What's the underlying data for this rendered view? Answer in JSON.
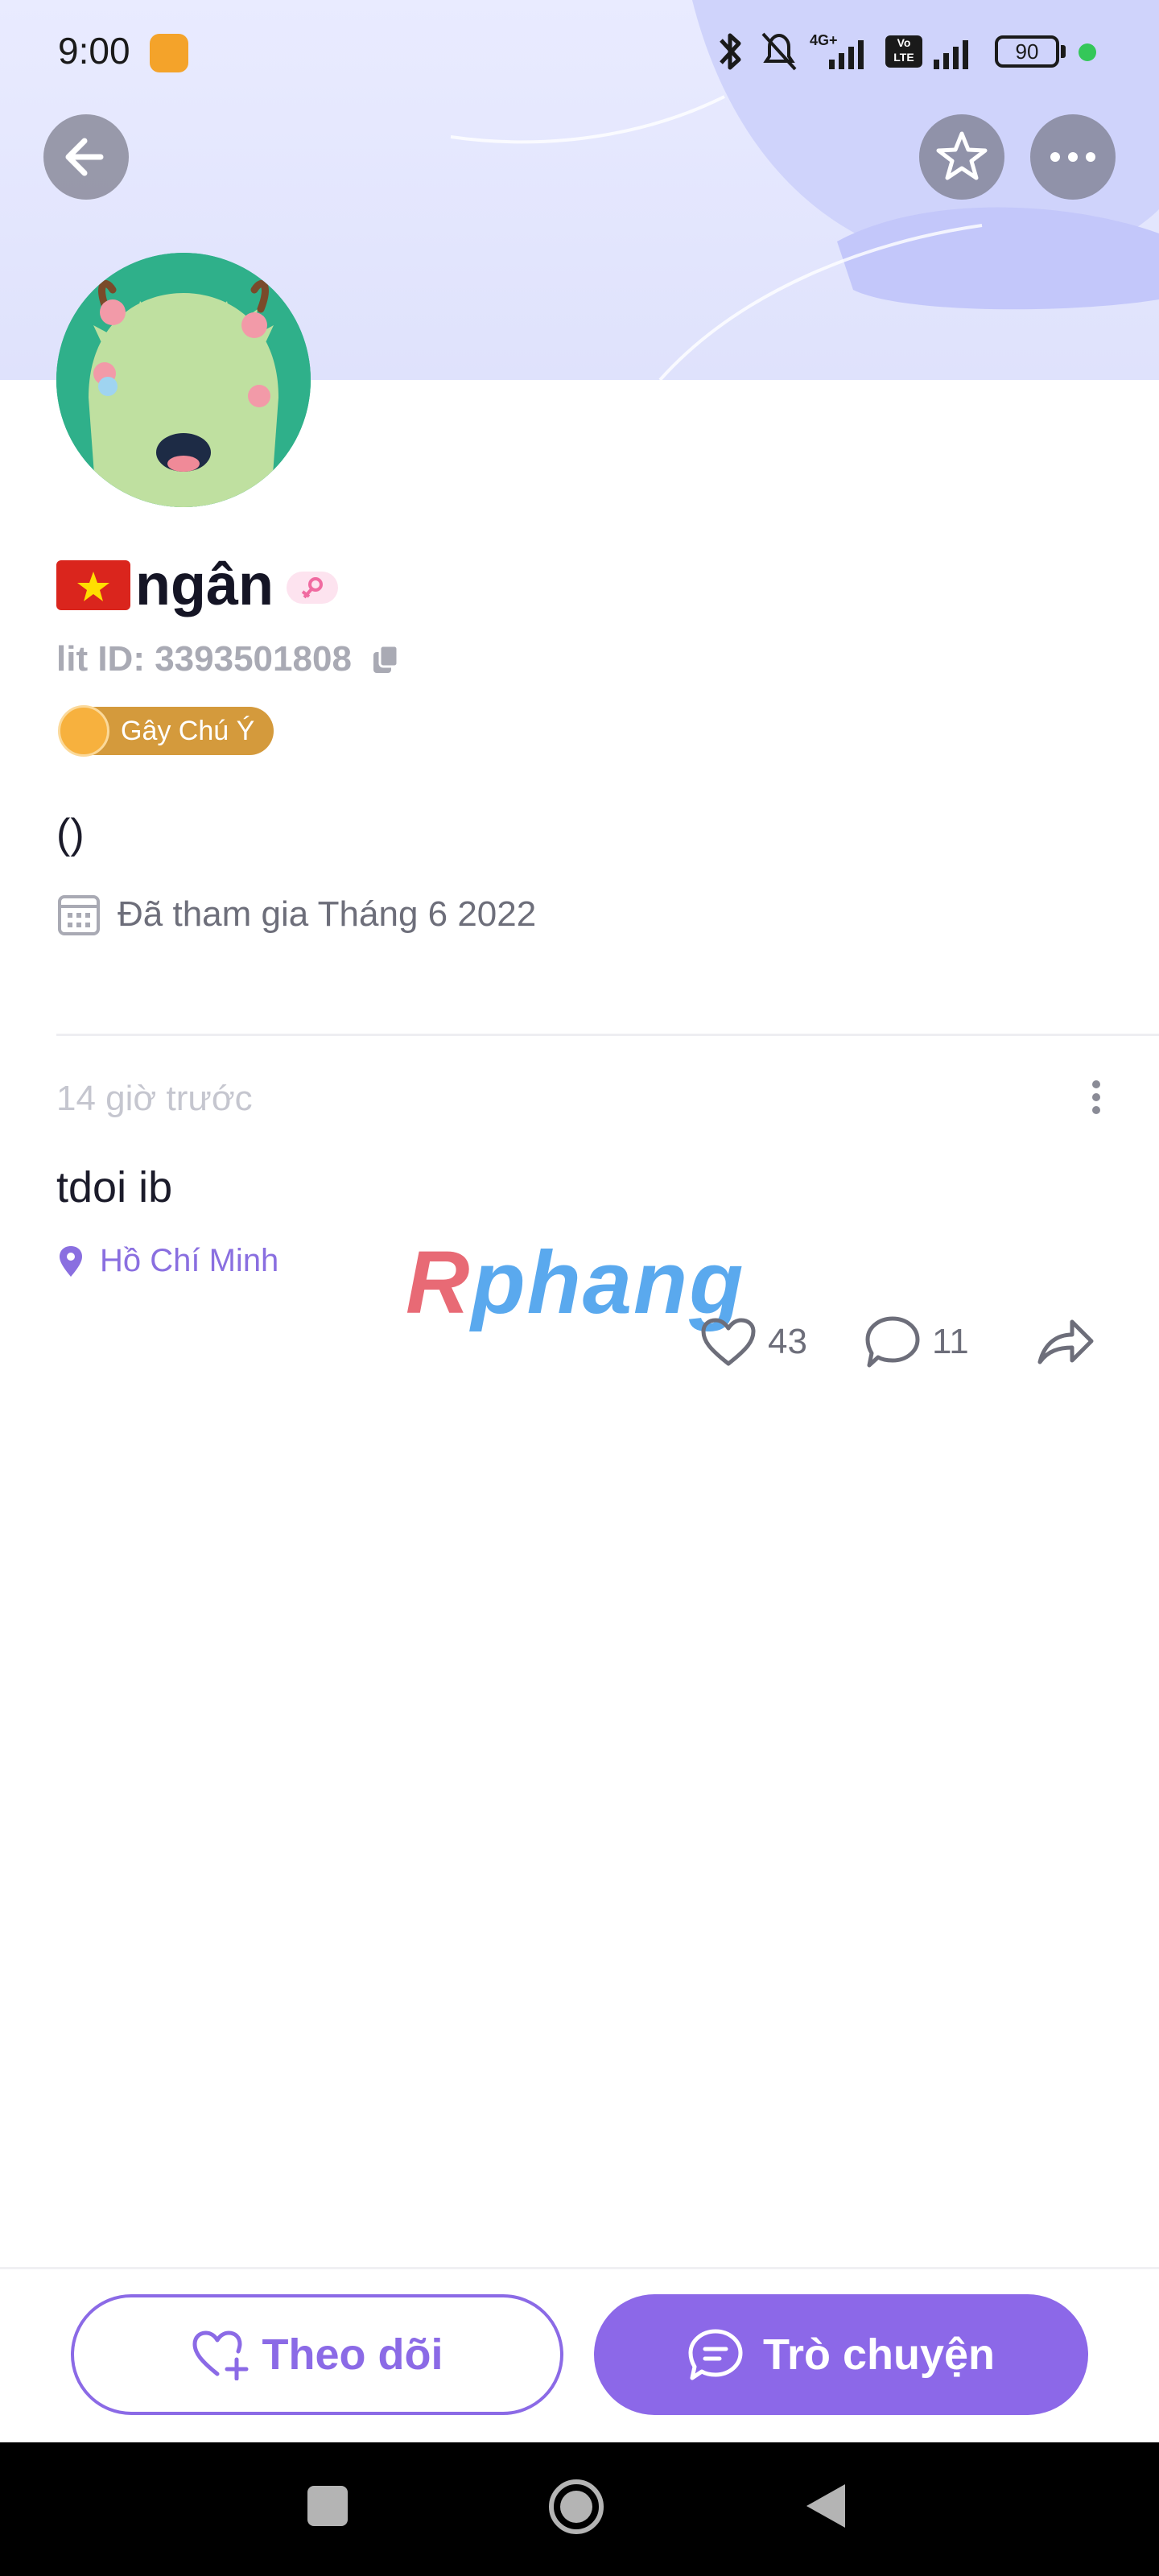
{
  "status_bar": {
    "time": "9:00",
    "network": "4G+",
    "volte": "Vo LTE",
    "battery": "90"
  },
  "header": {
    "back_icon": "arrow-left-icon",
    "favorite_icon": "star-icon",
    "more_icon": "ellipsis-icon"
  },
  "profile": {
    "name": "ngân",
    "flag": "vietnam-flag",
    "lit_id": "lit ID: 3393501808",
    "badge_label": "Gây Chú Ý",
    "bio": "()",
    "joined": "Đã tham gia Tháng 6 2022"
  },
  "post": {
    "time": "14 giờ trước",
    "text": "tdoi ib",
    "location": "Hồ Chí Minh",
    "likes": "43",
    "comments": "11"
  },
  "watermark": {
    "first": "R",
    "rest": "phang"
  },
  "actions": {
    "follow_label": "Theo dõi",
    "chat_label": "Trò chuyện"
  },
  "colors": {
    "accent": "#8c68e8",
    "location": "#8a6fe0",
    "badge": "#d49a3c"
  }
}
